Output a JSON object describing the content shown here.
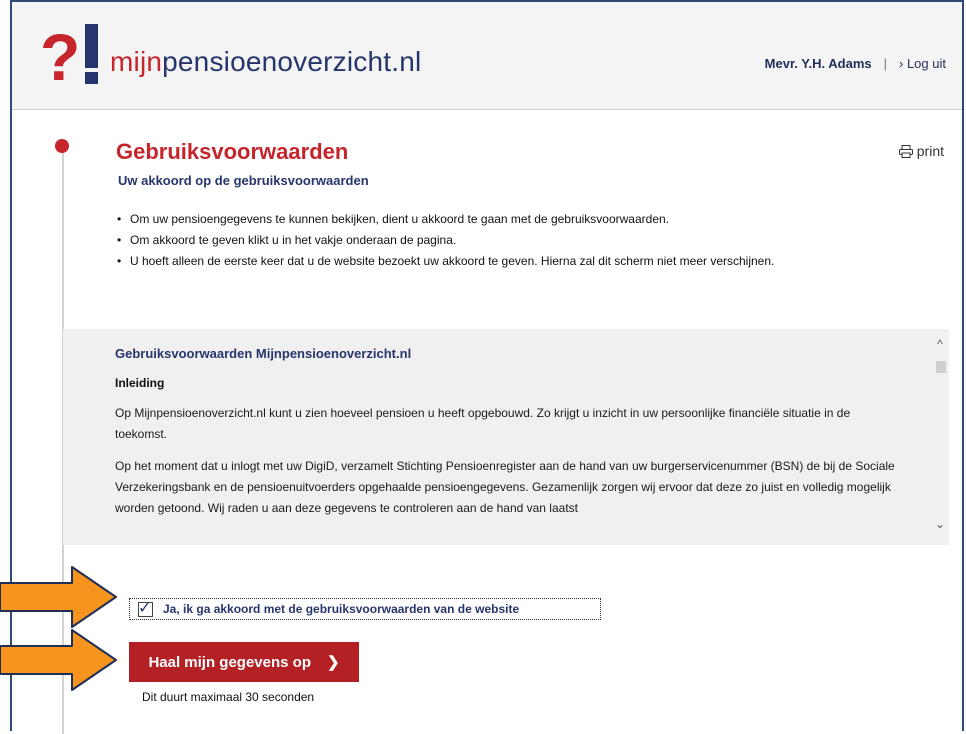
{
  "header": {
    "logo_part1": "mijn",
    "logo_part2": "pensioenoverzicht",
    "logo_part3": ".nl",
    "user_name": "Mevr. Y.H. Adams",
    "separator": "|",
    "logout_label": "› Log uit"
  },
  "page": {
    "title": "Gebruiksvoorwaarden",
    "print_label": "print",
    "subtitle": "Uw akkoord op de gebruiksvoorwaarden",
    "bullets": [
      "Om uw pensioengegevens te kunnen bekijken, dient u akkoord te gaan met de gebruiksvoorwaarden.",
      "Om akkoord te geven klikt u in het vakje onderaan de pagina.",
      "U hoeft alleen de eerste keer dat u de website bezoekt uw akkoord te geven. Hierna zal dit scherm niet meer verschijnen."
    ]
  },
  "terms": {
    "heading": "Gebruiksvoorwaarden Mijnpensioenoverzicht.nl",
    "section": "Inleiding",
    "paragraph1": "Op Mijnpensioenoverzicht.nl kunt u zien hoeveel pensioen u heeft opgebouwd. Zo krijgt u inzicht in uw persoonlijke financiële situatie in de toekomst.",
    "paragraph2": "Op het moment dat u inlogt met uw DigiD, verzamelt Stichting Pensioenregister aan de hand van uw burgerservicenummer (BSN) de bij de Sociale Verzekeringsbank en de pensioenuitvoerders opgehaalde pensioengegevens. Gezamenlijk zorgen wij ervoor dat deze zo juist en volledig mogelijk worden getoond. Wij raden u aan deze gegevens te controleren aan de hand van laatst"
  },
  "consent": {
    "checked": true,
    "label": "Ja, ik ga akkoord met de gebruiksvoorwaarden van de website"
  },
  "submit": {
    "label": "Haal mijn gegevens op",
    "chevron": "❯"
  },
  "note": "Dit duurt maximaal 30 seconden",
  "colors": {
    "brand_red": "#c6252c",
    "brand_navy": "#26356b",
    "button_red": "#b32124",
    "arrow_orange": "#f7941d"
  },
  "icons": {
    "logo": "question-exclamation-logo",
    "print": "printer-icon",
    "checkbox": "checkmark-icon",
    "scroll_up": "chevron-up-icon",
    "scroll_down": "chevron-down-icon",
    "annotation": "orange-arrow-icon"
  }
}
